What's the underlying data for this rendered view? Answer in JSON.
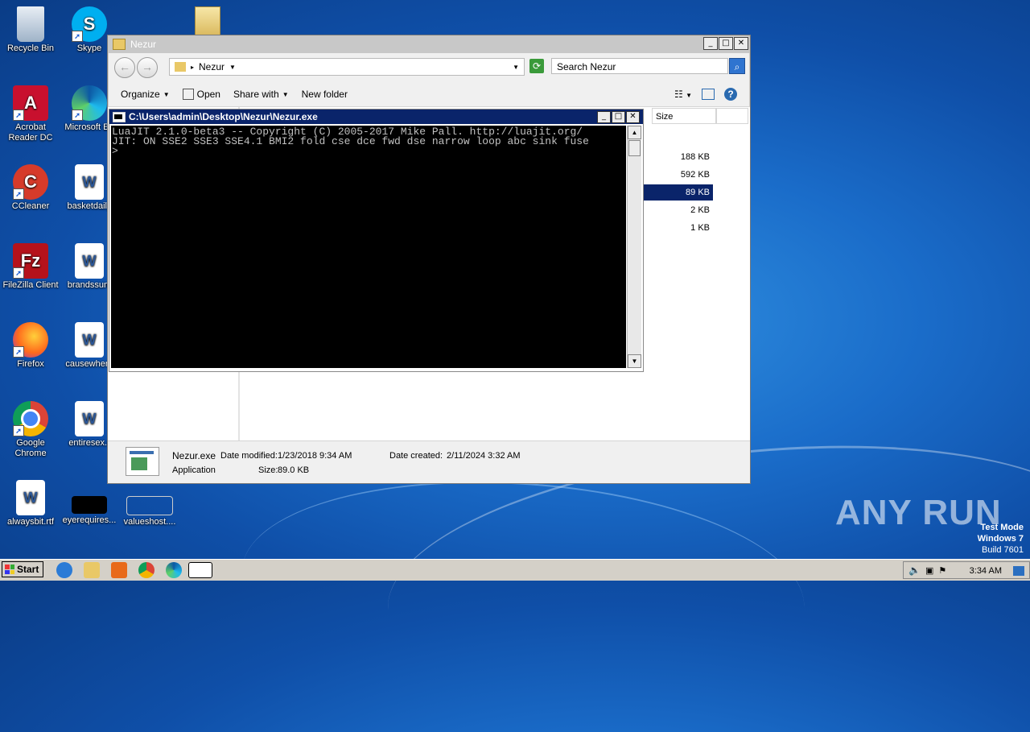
{
  "desktop": {
    "icons": [
      {
        "label": "Recycle Bin"
      },
      {
        "label": "Skype"
      },
      {
        "label": "Acrobat Reader DC"
      },
      {
        "label": "Microsoft Ed"
      },
      {
        "label": "CCleaner"
      },
      {
        "label": "basketdaily"
      },
      {
        "label": "FileZilla Client"
      },
      {
        "label": "brandssum"
      },
      {
        "label": "Firefox"
      },
      {
        "label": "causewhere"
      },
      {
        "label": "Google Chrome"
      },
      {
        "label": "entiresex.r"
      },
      {
        "label": "alwaysbit.rtf"
      },
      {
        "label": "eyerequires..."
      },
      {
        "label": "valueshost...."
      }
    ],
    "watermark_brand": "ANY RUN",
    "os_line1": "Test Mode",
    "os_line2": "Windows 7",
    "os_line3": "Build 7601"
  },
  "explorer": {
    "title": "Nezur",
    "address": "Nezur",
    "search_placeholder": "Search Nezur",
    "toolbar": {
      "organize": "Organize",
      "open": "Open",
      "share_with": "Share with",
      "new_folder": "New folder"
    },
    "column_size": "Size",
    "sizes": [
      "188 KB",
      "592 KB",
      "89 KB",
      "2 KB",
      "1 KB"
    ],
    "details": {
      "name": "Nezur.exe",
      "type": "Application",
      "date_modified_label": "Date modified:",
      "date_modified": "1/23/2018 9:34 AM",
      "size_label": "Size:",
      "size": "89.0 KB",
      "date_created_label": "Date created:",
      "date_created": "2/11/2024 3:32 AM"
    }
  },
  "console": {
    "title": "C:\\Users\\admin\\Desktop\\Nezur\\Nezur.exe",
    "lines": [
      "LuaJIT 2.1.0-beta3 -- Copyright (C) 2005-2017 Mike Pall. http://luajit.org/",
      "JIT: ON SSE2 SSE3 SSE4.1 BMI2 fold cse dce fwd dse narrow loop abc sink fuse",
      ">"
    ]
  },
  "taskbar": {
    "start": "Start",
    "clock": "3:34 AM"
  }
}
